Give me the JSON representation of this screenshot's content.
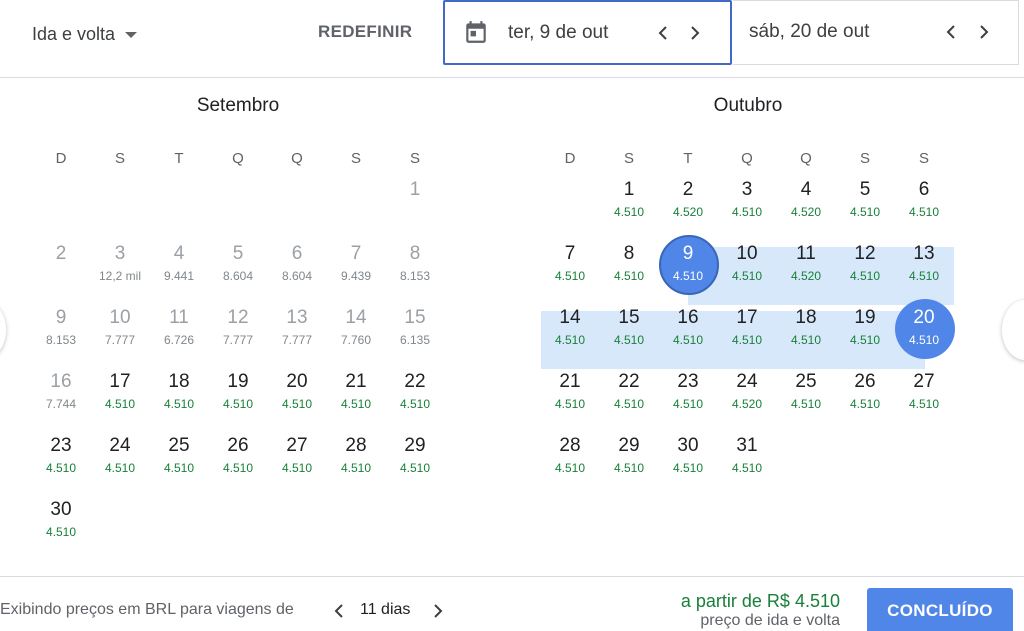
{
  "header": {
    "trip_type": "Ida e volta",
    "reset_label": "REDEFINIR",
    "departure_date": "ter, 9 de out",
    "return_date": "sáb, 20 de out"
  },
  "icons": {
    "calendar": "calendar-icon",
    "prev": "chevron-left-icon",
    "next": "chevron-right-icon",
    "dropdown": "caret-down-icon"
  },
  "colors": {
    "accent": "#4f86e8",
    "range": "#d8e8fb",
    "price": "#188038"
  },
  "calendar": {
    "weekdays": [
      "D",
      "S",
      "T",
      "Q",
      "Q",
      "S",
      "S"
    ],
    "months": [
      {
        "name": "Setembro",
        "days": [
          {
            "n": "1",
            "p": ""
          },
          {
            "n": "2",
            "p": ""
          },
          {
            "n": "3",
            "p": "12,2 mil"
          },
          {
            "n": "4",
            "p": "9.441"
          },
          {
            "n": "5",
            "p": "8.604"
          },
          {
            "n": "6",
            "p": "8.604"
          },
          {
            "n": "7",
            "p": "9.439"
          },
          {
            "n": "8",
            "p": "8.153"
          },
          {
            "n": "9",
            "p": "8.153"
          },
          {
            "n": "10",
            "p": "7.777"
          },
          {
            "n": "11",
            "p": "6.726"
          },
          {
            "n": "12",
            "p": "7.777"
          },
          {
            "n": "13",
            "p": "7.777"
          },
          {
            "n": "14",
            "p": "7.760"
          },
          {
            "n": "15",
            "p": "6.135"
          },
          {
            "n": "16",
            "p": "7.744"
          },
          {
            "n": "17",
            "p": "4.510"
          },
          {
            "n": "18",
            "p": "4.510"
          },
          {
            "n": "19",
            "p": "4.510"
          },
          {
            "n": "20",
            "p": "4.510"
          },
          {
            "n": "21",
            "p": "4.510"
          },
          {
            "n": "22",
            "p": "4.510"
          },
          {
            "n": "23",
            "p": "4.510"
          },
          {
            "n": "24",
            "p": "4.510"
          },
          {
            "n": "25",
            "p": "4.510"
          },
          {
            "n": "26",
            "p": "4.510"
          },
          {
            "n": "27",
            "p": "4.510"
          },
          {
            "n": "28",
            "p": "4.510"
          },
          {
            "n": "29",
            "p": "4.510"
          },
          {
            "n": "30",
            "p": "4.510"
          }
        ]
      },
      {
        "name": "Outubro",
        "days": [
          {
            "n": "1",
            "p": "4.510"
          },
          {
            "n": "2",
            "p": "4.520"
          },
          {
            "n": "3",
            "p": "4.510"
          },
          {
            "n": "4",
            "p": "4.520"
          },
          {
            "n": "5",
            "p": "4.510"
          },
          {
            "n": "6",
            "p": "4.510"
          },
          {
            "n": "7",
            "p": "4.510"
          },
          {
            "n": "8",
            "p": "4.510"
          },
          {
            "n": "9",
            "p": "4.510"
          },
          {
            "n": "10",
            "p": "4.510"
          },
          {
            "n": "11",
            "p": "4.520"
          },
          {
            "n": "12",
            "p": "4.510"
          },
          {
            "n": "13",
            "p": "4.510"
          },
          {
            "n": "14",
            "p": "4.510"
          },
          {
            "n": "15",
            "p": "4.510"
          },
          {
            "n": "16",
            "p": "4.510"
          },
          {
            "n": "17",
            "p": "4.510"
          },
          {
            "n": "18",
            "p": "4.510"
          },
          {
            "n": "19",
            "p": "4.510"
          },
          {
            "n": "20",
            "p": "4.510"
          },
          {
            "n": "21",
            "p": "4.510"
          },
          {
            "n": "22",
            "p": "4.510"
          },
          {
            "n": "23",
            "p": "4.510"
          },
          {
            "n": "24",
            "p": "4.520"
          },
          {
            "n": "25",
            "p": "4.510"
          },
          {
            "n": "26",
            "p": "4.510"
          },
          {
            "n": "27",
            "p": "4.510"
          },
          {
            "n": "28",
            "p": "4.510"
          },
          {
            "n": "29",
            "p": "4.510"
          },
          {
            "n": "30",
            "p": "4.510"
          },
          {
            "n": "31",
            "p": "4.510"
          }
        ]
      }
    ]
  },
  "footer": {
    "currency_note": "Exibindo preços em BRL para viagens de",
    "trip_length": "11 dias",
    "price_from": "a partir de R$ 4.510",
    "price_type": "preço de ida e volta",
    "done_label": "CONCLUÍDO"
  }
}
